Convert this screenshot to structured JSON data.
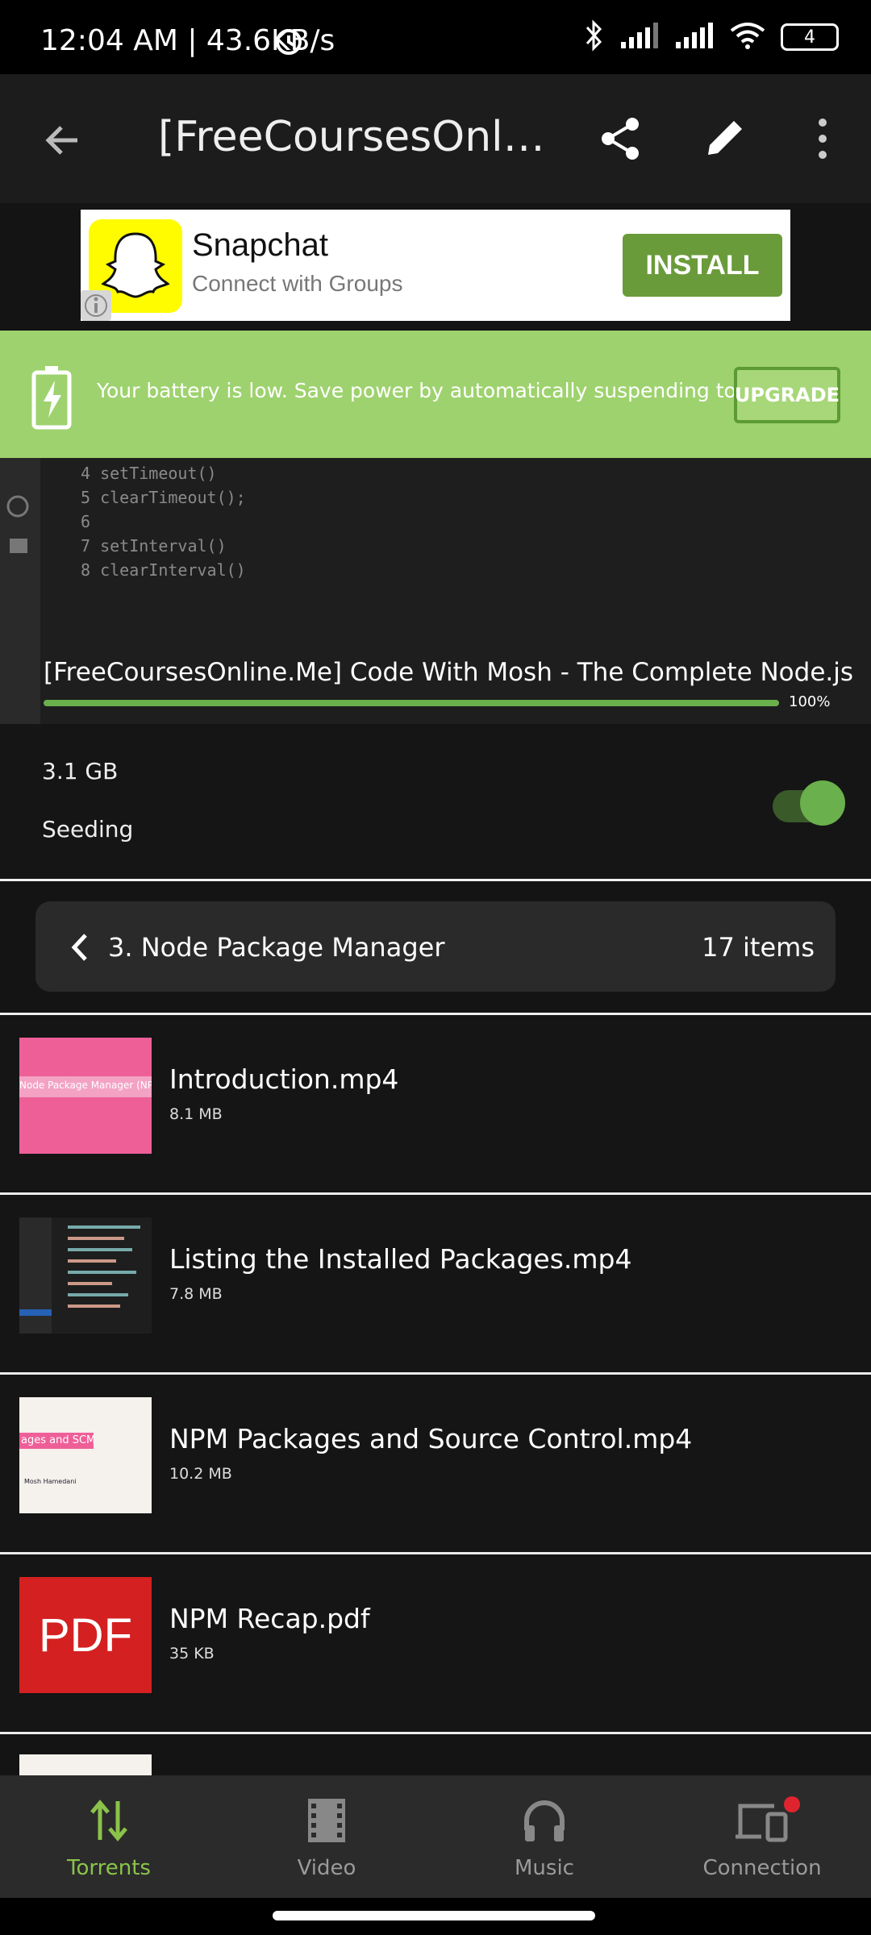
{
  "status_bar": {
    "time": "12:04 AM | 43.6KB/s",
    "battery": "4"
  },
  "top_bar": {
    "title": "[FreeCoursesOnline...."
  },
  "ad": {
    "app_name": "Snapchat",
    "tagline": "Connect with Groups",
    "install_label": "INSTALL"
  },
  "battery_banner": {
    "message": "Your battery is low. Save power by automatically suspending torrents",
    "upgrade_label": "UPGRADE"
  },
  "preview": {
    "code_lines": [
      "4   setTimeout()",
      "5   clearTimeout();",
      "6",
      "7   setInterval()",
      "8   clearInterval()"
    ],
    "torrent_title": "[FreeCoursesOnline.Me] Code With Mosh - The Complete Node.js",
    "progress_label": "100%",
    "progress": 1.0
  },
  "info": {
    "size": "3.1 GB",
    "state": "Seeding",
    "seeding_enabled": true
  },
  "folder": {
    "name": "3. Node Package Manager",
    "count": "17 items"
  },
  "files": [
    {
      "name": "Introduction.mp4",
      "size": "8.1 MB",
      "thumb_text": "Node Package Manager (NPM)"
    },
    {
      "name": "Listing the Installed Packages.mp4",
      "size": "7.8 MB",
      "thumb_text": ""
    },
    {
      "name": "NPM Packages and Source Control.mp4",
      "size": "10.2 MB",
      "thumb_text": "ages and SCM",
      "thumb_sub": "Mosh Hamedani"
    },
    {
      "name": "NPM Recap.pdf",
      "size": "35 KB",
      "thumb_text": "PDF"
    }
  ],
  "bottom_nav": [
    {
      "label": "Torrents",
      "icon": "transfer-arrows-icon",
      "active": true
    },
    {
      "label": "Video",
      "icon": "film-icon",
      "active": false
    },
    {
      "label": "Music",
      "icon": "headphones-icon",
      "active": false
    },
    {
      "label": "Connection",
      "icon": "devices-icon",
      "active": false
    }
  ],
  "colors": {
    "accent": "#6ab04c",
    "banner": "#9ed26e",
    "background": "#141414"
  }
}
